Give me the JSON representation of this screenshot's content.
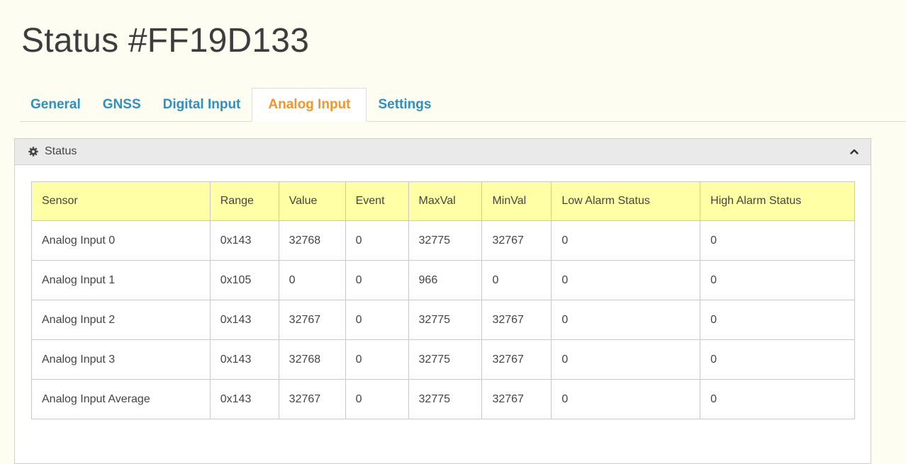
{
  "page": {
    "title": "Status #FF19D133"
  },
  "tabs": [
    {
      "label": "General",
      "active": false
    },
    {
      "label": "GNSS",
      "active": false
    },
    {
      "label": "Digital Input",
      "active": false
    },
    {
      "label": "Analog Input",
      "active": true
    },
    {
      "label": "Settings",
      "active": false
    }
  ],
  "panel": {
    "title": "Status",
    "icon": "gear-icon",
    "collapse_icon": "chevron-up-icon"
  },
  "table": {
    "headers": [
      "Sensor",
      "Range",
      "Value",
      "Event",
      "MaxVal",
      "MinVal",
      "Low Alarm Status",
      "High Alarm Status"
    ],
    "rows": [
      [
        "Analog Input 0",
        "0x143",
        "32768",
        "0",
        "32775",
        "32767",
        "0",
        "0"
      ],
      [
        "Analog Input 1",
        "0x105",
        "0",
        "0",
        "966",
        "0",
        "0",
        "0"
      ],
      [
        "Analog Input 2",
        "0x143",
        "32767",
        "0",
        "32775",
        "32767",
        "0",
        "0"
      ],
      [
        "Analog Input 3",
        "0x143",
        "32768",
        "0",
        "32775",
        "32767",
        "0",
        "0"
      ],
      [
        "Analog Input Average",
        "0x143",
        "32767",
        "0",
        "32775",
        "32767",
        "0",
        "0"
      ]
    ]
  },
  "colors": {
    "background": "#fdfdf2",
    "tab_link": "#2e8fc0",
    "tab_active": "#f0962d",
    "table_header": "#ffffa6"
  }
}
